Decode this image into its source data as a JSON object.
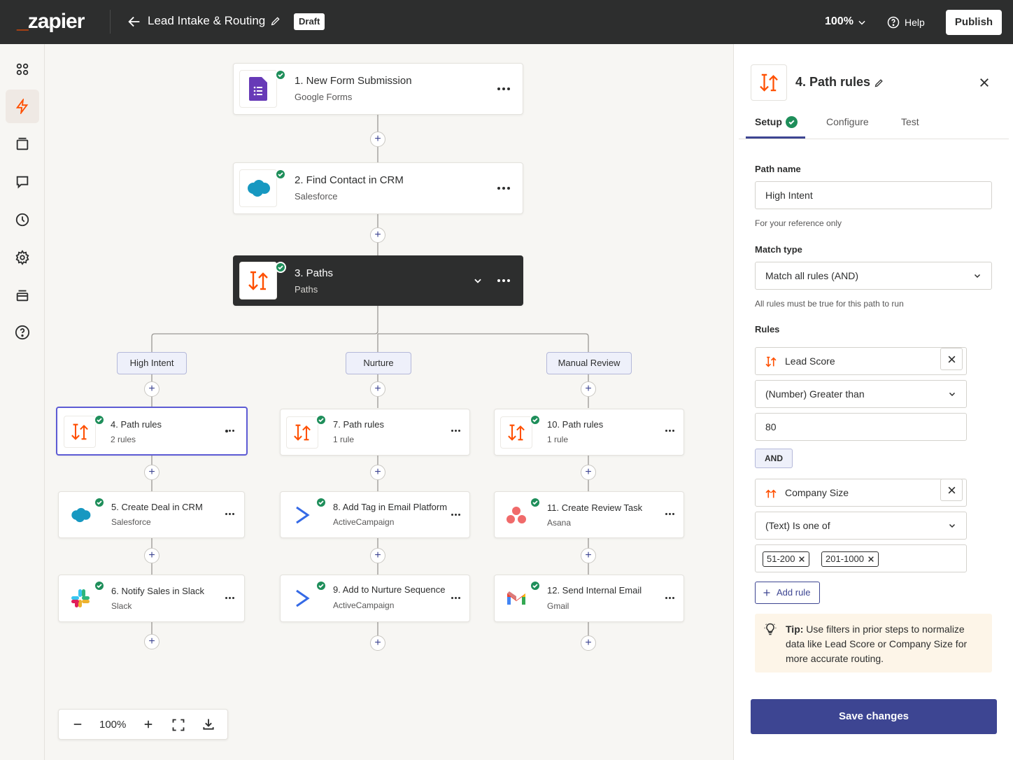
{
  "topbar": {
    "logo": "zapier",
    "title": "Lead Intake & Routing",
    "status": "Draft",
    "zoom": "100%",
    "help": "Help",
    "publish": "Publish"
  },
  "rail": {
    "items": [
      "apps-icon",
      "zap-icon",
      "tables-icon",
      "interfaces-icon",
      "history-icon",
      "settings-icon",
      "archive-icon",
      "help-icon"
    ]
  },
  "canvas": {
    "steps": {
      "s1": {
        "title": "1. New Form Submission",
        "app": "Google Forms"
      },
      "s2": {
        "title": "2. Find Contact in CRM",
        "app": "Salesforce"
      },
      "s3": {
        "title": "3. Paths",
        "app": "Paths"
      },
      "s4": {
        "title": "4. Path rules",
        "app": "2 rules"
      },
      "s5": {
        "title": "5. Create Deal in CRM",
        "app": "Salesforce"
      },
      "s6": {
        "title": "6. Notify Sales in Slack",
        "app": "Slack"
      },
      "s7": {
        "title": "7. Path rules",
        "app": "1 rule"
      },
      "s8": {
        "title": "8. Add Tag in Email Platform",
        "app": "ActiveCampaign"
      },
      "s9": {
        "title": "9. Add to Nurture Sequence",
        "app": "ActiveCampaign"
      },
      "s10": {
        "title": "10. Path rules",
        "app": "1 rule"
      },
      "s11": {
        "title": "11. Create Review Task",
        "app": "Asana"
      },
      "s12": {
        "title": "12. Send Internal Email",
        "app": "Gmail"
      }
    },
    "branches": [
      "High Intent",
      "Nurture",
      "Manual Review"
    ],
    "zoom": "100%"
  },
  "panel": {
    "title": "4. Path rules",
    "tabs": [
      "Setup",
      "Configure",
      "Test"
    ],
    "path_name_label": "Path name",
    "path_name_value": "High Intent",
    "path_name_help": "For your reference only",
    "match_type_label": "Match type",
    "match_type_value": "Match all rules (AND)",
    "match_type_help": "All rules must be true for this path to run",
    "rules_label": "Rules",
    "rule1": {
      "field": "Lead Score",
      "operator": "(Number) Greater than",
      "value": "80"
    },
    "and_label": "AND",
    "rule2": {
      "field": "Company Size",
      "operator": "(Text) Is one of",
      "values": [
        "51-200",
        "201-1000"
      ]
    },
    "add_rule": "Add rule",
    "tip_bold": "Tip:",
    "tip_text": "Use filters in prior steps to normalize data like Lead Score or Company Size for more accurate routing.",
    "save": "Save changes"
  },
  "colors": {
    "brand_orange": "#ff4f00",
    "primary": "#3d4592",
    "success": "#1e8e5a",
    "topbar": "#2d2e2e"
  }
}
